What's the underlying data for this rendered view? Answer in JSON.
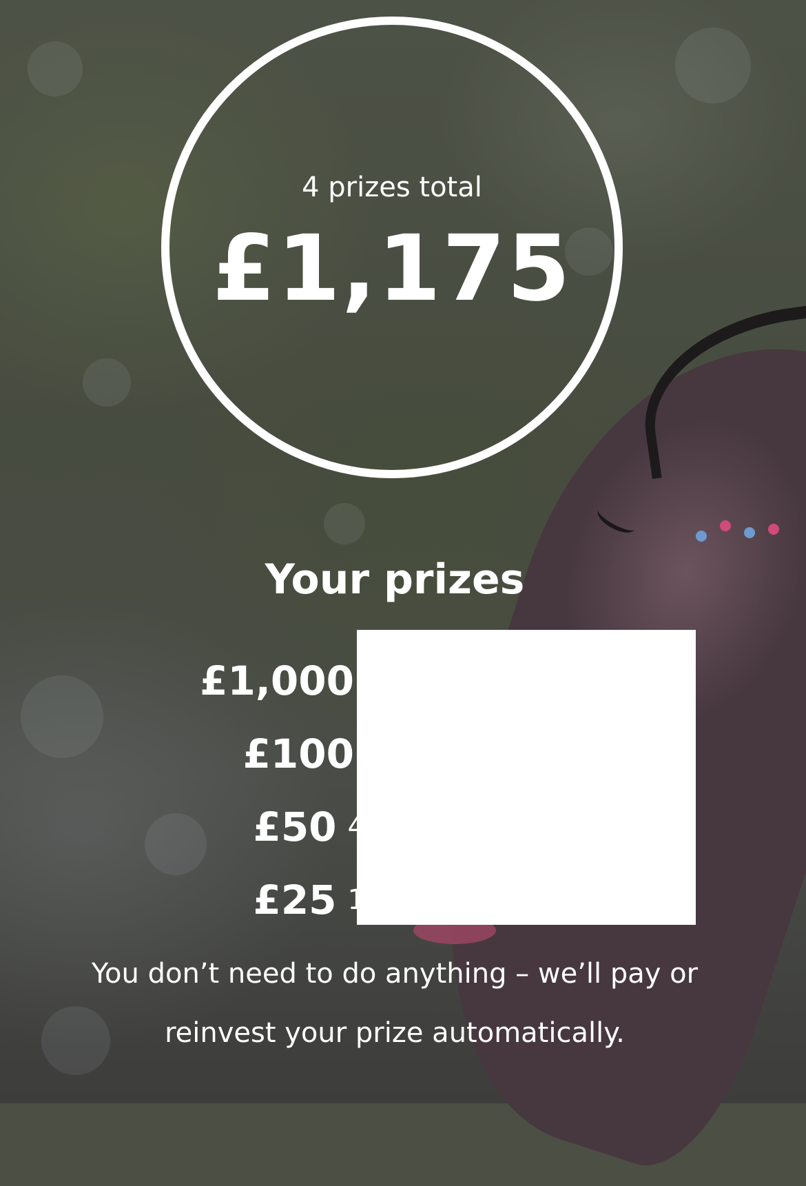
{
  "summary": {
    "caption": "4 prizes total",
    "total": "£1,175"
  },
  "prizes": {
    "title": "Your prizes",
    "rows": [
      {
        "amount": "£1,000",
        "detail": ""
      },
      {
        "amount": "£100",
        "detail": ""
      },
      {
        "amount": "£50",
        "detail": "4"
      },
      {
        "amount": "£25",
        "detail": "1"
      }
    ]
  },
  "note": "You don’t need to do anything – we’ll pay or reinvest your prize automatically.",
  "colors": {
    "text": "#ffffff",
    "ring": "#ffffff",
    "redaction": "#ffffff"
  }
}
